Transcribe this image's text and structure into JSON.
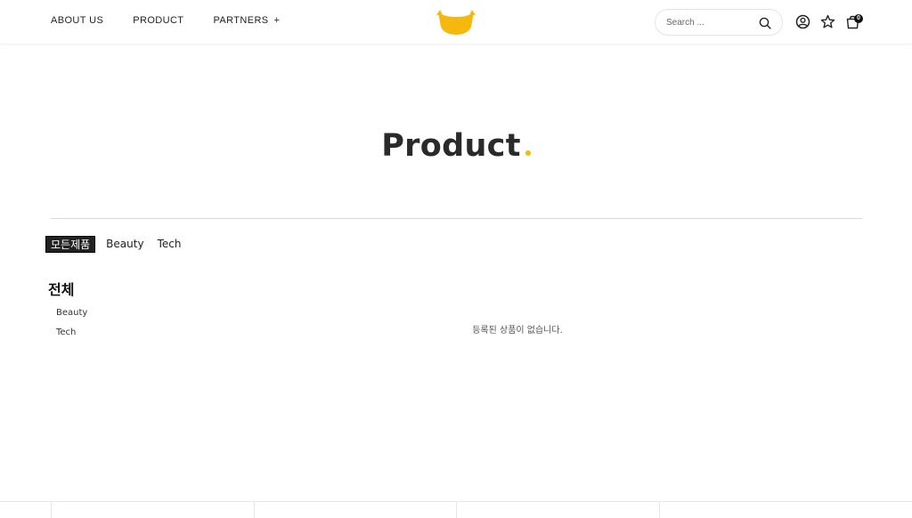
{
  "nav": {
    "items": [
      {
        "label": "ABOUT US"
      },
      {
        "label": "PRODUCT"
      },
      {
        "label": "PARTNERS"
      }
    ],
    "partners_expand": "+"
  },
  "brand": {
    "accent_color": "#f5b80c"
  },
  "search": {
    "placeholder": "Search ..."
  },
  "header_icons": {
    "account": "user-circle-icon",
    "wishlist": "star-icon",
    "cart": "shopping-bag-icon",
    "cart_count": "0"
  },
  "hero": {
    "title": "Product"
  },
  "tabs": [
    {
      "label": "모든제품",
      "active": true
    },
    {
      "label": "Beauty",
      "active": false
    },
    {
      "label": "Tech",
      "active": false
    }
  ],
  "sidebar": {
    "title": "전체",
    "items": [
      {
        "label": "Beauty"
      },
      {
        "label": "Tech"
      }
    ]
  },
  "main": {
    "empty_message": "등록된 상품이 없습니다."
  }
}
